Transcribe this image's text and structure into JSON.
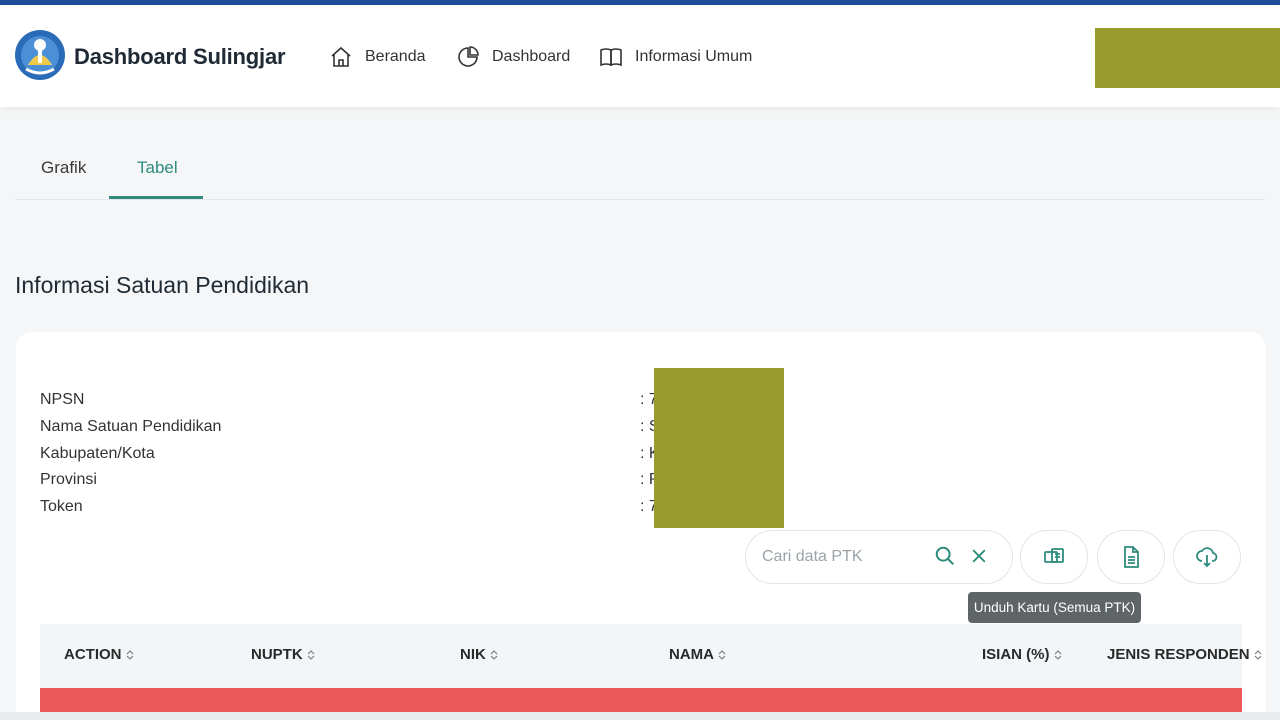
{
  "header": {
    "brand": "Dashboard Sulingjar",
    "nav": [
      {
        "label": "Beranda",
        "icon": "home-icon"
      },
      {
        "label": "Dashboard",
        "icon": "pie-chart-icon"
      },
      {
        "label": "Informasi Umum",
        "icon": "book-icon"
      }
    ]
  },
  "tabs": [
    {
      "label": "Grafik",
      "active": false
    },
    {
      "label": "Tabel",
      "active": true
    }
  ],
  "section_title": "Informasi Satuan Pendidikan",
  "info": [
    {
      "label": "NPSN",
      "value": ": 7"
    },
    {
      "label": "Nama Satuan Pendidikan",
      "value": ": S"
    },
    {
      "label": "Kabupaten/Kota",
      "value": ": K"
    },
    {
      "label": "Provinsi",
      "value": ": P"
    },
    {
      "label": "Token",
      "value": ": 7"
    }
  ],
  "search": {
    "placeholder": "Cari data PTK",
    "value": ""
  },
  "tooltip": "Unduh Kartu (Semua PTK)",
  "table": {
    "columns": [
      "ACTION",
      "NUPTK",
      "NIK",
      "NAMA",
      "ISIAN (%)",
      "JENIS RESPONDEN"
    ]
  },
  "colors": {
    "accent": "#2f8b7d",
    "topline": "#1d4e9a",
    "redacted": "#979c2d",
    "row_highlight": "#ee5a5a"
  }
}
